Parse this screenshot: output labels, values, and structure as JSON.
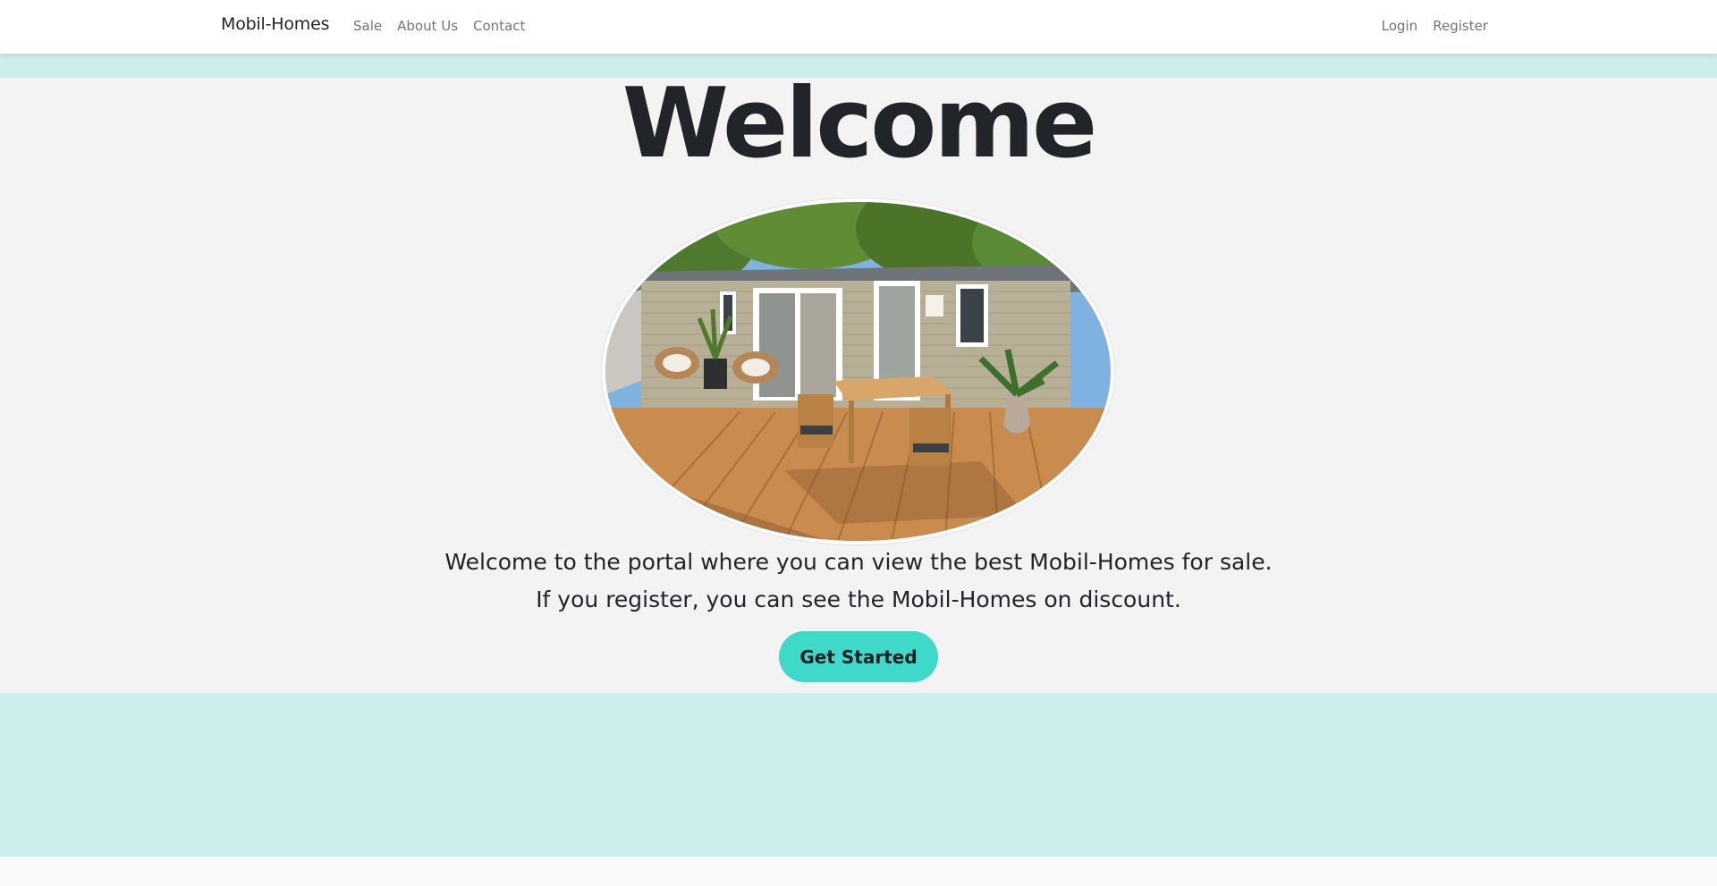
{
  "navbar": {
    "brand": "Mobil-Homes",
    "left_links": [
      "Sale",
      "About Us",
      "Contact"
    ],
    "right_links": [
      "Login",
      "Register"
    ]
  },
  "hero": {
    "title": "Welcome",
    "image": {
      "alt": "Mobile home with wooden deck, table and chairs"
    },
    "line1": "Welcome to the portal where you can view the best Mobil-Homes for sale.",
    "line2": "If you register, you can see the Mobil-Homes on discount.",
    "cta_label": "Get Started"
  },
  "colors": {
    "teal_band": "#cdefeb",
    "hero_bg": "#f3f3f3",
    "cta": "#3fd9c9",
    "text": "#212529",
    "nav_link": "#6c757d"
  }
}
